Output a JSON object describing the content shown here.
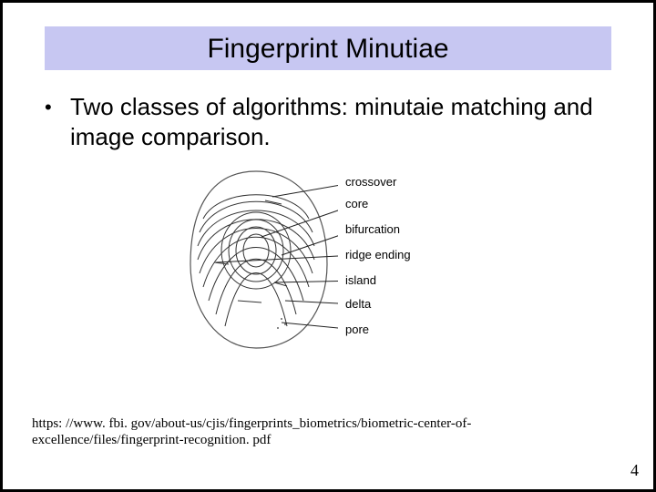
{
  "title": "Fingerprint Minutiae",
  "bullets": [
    "Two classes of algorithms: minutaie matching and image comparison."
  ],
  "figure": {
    "labels": {
      "crossover": "crossover",
      "core": "core",
      "bifurcation": "bifurcation",
      "ridge_ending": "ridge ending",
      "island": "island",
      "delta": "delta",
      "pore": "pore"
    }
  },
  "citation": "https: //www. fbi. gov/about-us/cjis/fingerprints_biometrics/biometric-center-of-excellence/files/fingerprint-recognition. pdf",
  "page_number": "4"
}
